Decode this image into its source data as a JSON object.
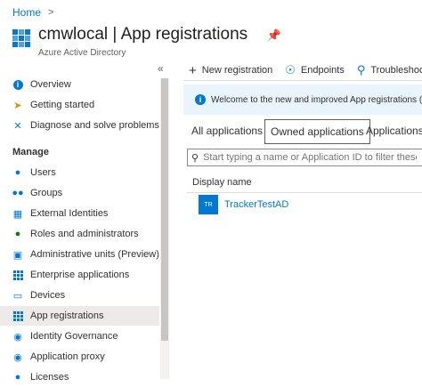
{
  "breadcrumb": {
    "home": "Home",
    "separator": ">"
  },
  "header": {
    "tenant": "cmwlocal",
    "divider": "|",
    "page": "App registrations",
    "subtitle": "Azure Active Directory"
  },
  "sidebar": {
    "collapse_glyph": "«",
    "section_manage": "Manage",
    "items": [
      {
        "label": "Overview",
        "icon": "info-icon"
      },
      {
        "label": "Getting started",
        "icon": "rocket-icon"
      },
      {
        "label": "Diagnose and solve problems",
        "icon": "wrench-icon"
      },
      {
        "label": "Users",
        "icon": "user-icon"
      },
      {
        "label": "Groups",
        "icon": "groups-icon"
      },
      {
        "label": "External Identities",
        "icon": "external-identities-icon"
      },
      {
        "label": "Roles and administrators",
        "icon": "roles-icon"
      },
      {
        "label": "Administrative units (Preview)",
        "icon": "admin-units-icon"
      },
      {
        "label": "Enterprise applications",
        "icon": "enterprise-apps-icon"
      },
      {
        "label": "Devices",
        "icon": "devices-icon"
      },
      {
        "label": "App registrations",
        "icon": "app-registrations-icon"
      },
      {
        "label": "Identity Governance",
        "icon": "identity-governance-icon"
      },
      {
        "label": "Application proxy",
        "icon": "application-proxy-icon"
      },
      {
        "label": "Licenses",
        "icon": "licenses-icon"
      }
    ]
  },
  "toolbar": {
    "new_registration": "New registration",
    "endpoints": "Endpoints",
    "troubleshooting": "Troubleshooting"
  },
  "banner": {
    "text": "Welcome to the new and improved App registrations (now Ge"
  },
  "tabs": [
    {
      "label": "All applications"
    },
    {
      "label": "Owned applications"
    },
    {
      "label": "Applications f"
    }
  ],
  "filter": {
    "placeholder": "Start typing a name or Application ID to filter these results"
  },
  "table": {
    "column_display_name": "Display name",
    "rows": [
      {
        "initials": "TR",
        "name": "TrackerTestAD"
      }
    ]
  },
  "colors": {
    "accent": "#0078d4",
    "banner_bg": "#eaf4fd",
    "active_nav_bg": "#edebe9"
  }
}
